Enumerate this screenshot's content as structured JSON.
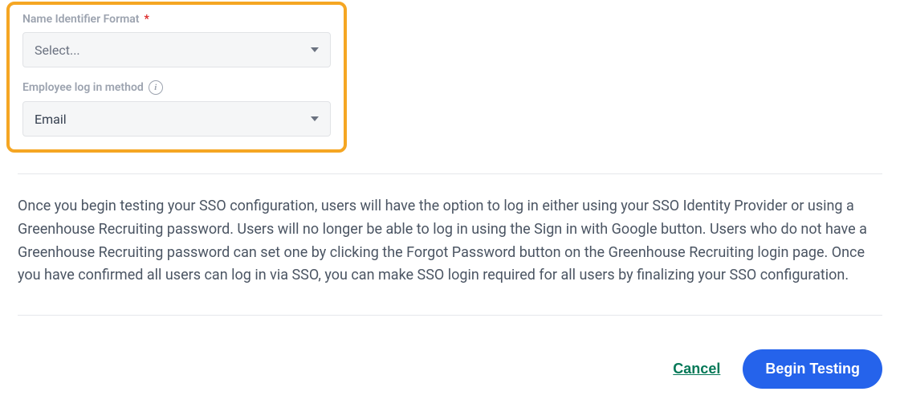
{
  "fields": {
    "nameIdentifier": {
      "label": "Name Identifier Format",
      "value": "Select...",
      "required": true
    },
    "employeeLogin": {
      "label": "Employee log in method",
      "value": "Email"
    }
  },
  "bodyText": "Once you begin testing your SSO configuration, users will have the option to log in either using your SSO Identity Provider or using a Greenhouse Recruiting password. Users will no longer be able to log in using the Sign in with Google button. Users who do not have a Greenhouse Recruiting password can set one by clicking the Forgot Password button on the Greenhouse Recruiting login page. Once you have confirmed all users can log in via SSO, you can make SSO login required for all users by finalizing your SSO configuration.",
  "actions": {
    "cancel": "Cancel",
    "beginTesting": "Begin Testing"
  }
}
